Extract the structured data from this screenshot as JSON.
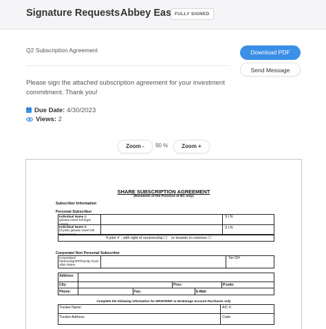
{
  "header": {
    "breadcrumb_root": "Signature Requests",
    "separator": "›",
    "breadcrumb_current": "Abbey East",
    "status_badge": "FULLY SIGNED"
  },
  "request": {
    "subject": "Q2 Subscription Agreement",
    "message": "Please sign the attached subscription agreement for your investment commitment. Thank you!",
    "due_label": "Due Date:",
    "due_value": "4/30/2023",
    "views_label": "Views:",
    "views_value": "2"
  },
  "actions": {
    "download_pdf": "Download PDF",
    "send_message": "Send Message"
  },
  "zoom": {
    "zoom_out": "Zoom -",
    "zoom_in": "Zoom +",
    "level": "90 %"
  },
  "colors": {
    "accent": "#3b8fe6",
    "header_bg": "#f5f5f7"
  },
  "icons": {
    "due": "calendar-icon",
    "views": "eye-icon"
  },
  "document": {
    "title": "SHARE SUBSCRIPTION AGREEMENT",
    "subtitle": "(Residents of the Province of BC only)",
    "subscriber_info": "Subscriber Information",
    "personal_subscriber": "Personal Subscriber",
    "individual_1": "Individual   Name 1:",
    "individual_1_note": "(please insert full legal name)",
    "individual_2": "Individual   Name 2:",
    "individual_2_note": "(if joint) (please insert full legal name)",
    "sin_1": "S.I.N.",
    "sin_2": "S.I.N.",
    "if_joint": "If joint",
    "check_mark": "✔",
    "survivorship": "; with right of survivorship ☐",
    "tenants_common": "or tenants in common ☐",
    "corporate_header": "Corporate/ Non Personal Subscriber",
    "corporate_label": "Corporation/ Partnership/IPP/Family Trust/ other Name:",
    "tax_id": "Tax ID#",
    "address": "Address:",
    "city": "City:",
    "prov": "Prov:",
    "pcode": "Pcode:",
    "phone": "Phone:",
    "fax": "Fax:",
    "email": "E-Mail",
    "rrsp_note": "Complete the following information for RRSP/RRIF or Brokerage Account Purchases only",
    "trustee_name": "Trustee Name:",
    "account_no": "A/C #:",
    "trustee_address": "Trustee Address:",
    "code": "Code:"
  }
}
